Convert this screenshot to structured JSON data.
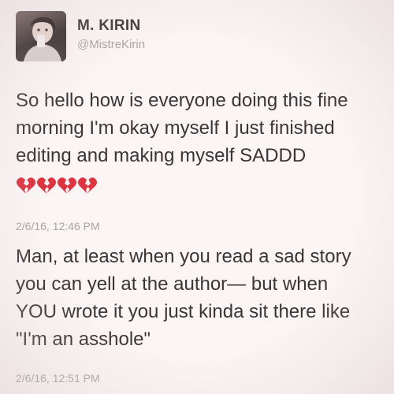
{
  "author": {
    "name": "M. KIRIN",
    "handle": "@MistreKirin",
    "avatar_icon": "user-photo-avatar"
  },
  "tweets": [
    {
      "text": "So hello how is everyone doing this fine\nmorning I'm okay myself I just finished\nediting and making myself SADDD",
      "emoji": [
        "broken-heart-icon",
        "broken-heart-icon",
        "broken-heart-icon",
        "broken-heart-icon"
      ],
      "timestamp": "2/6/16, 12:46 PM"
    },
    {
      "text": "Man, at least when you read a sad story\nyou can yell at the author— but when\nYOU wrote it you just kinda sit there like\n\"I'm an asshole\"",
      "timestamp": "2/6/16, 12:51 PM"
    }
  ],
  "colors": {
    "background": "#fbf5f5",
    "text": "#3a3536",
    "muted": "#a9a3a5",
    "heart": "#e0323f"
  }
}
